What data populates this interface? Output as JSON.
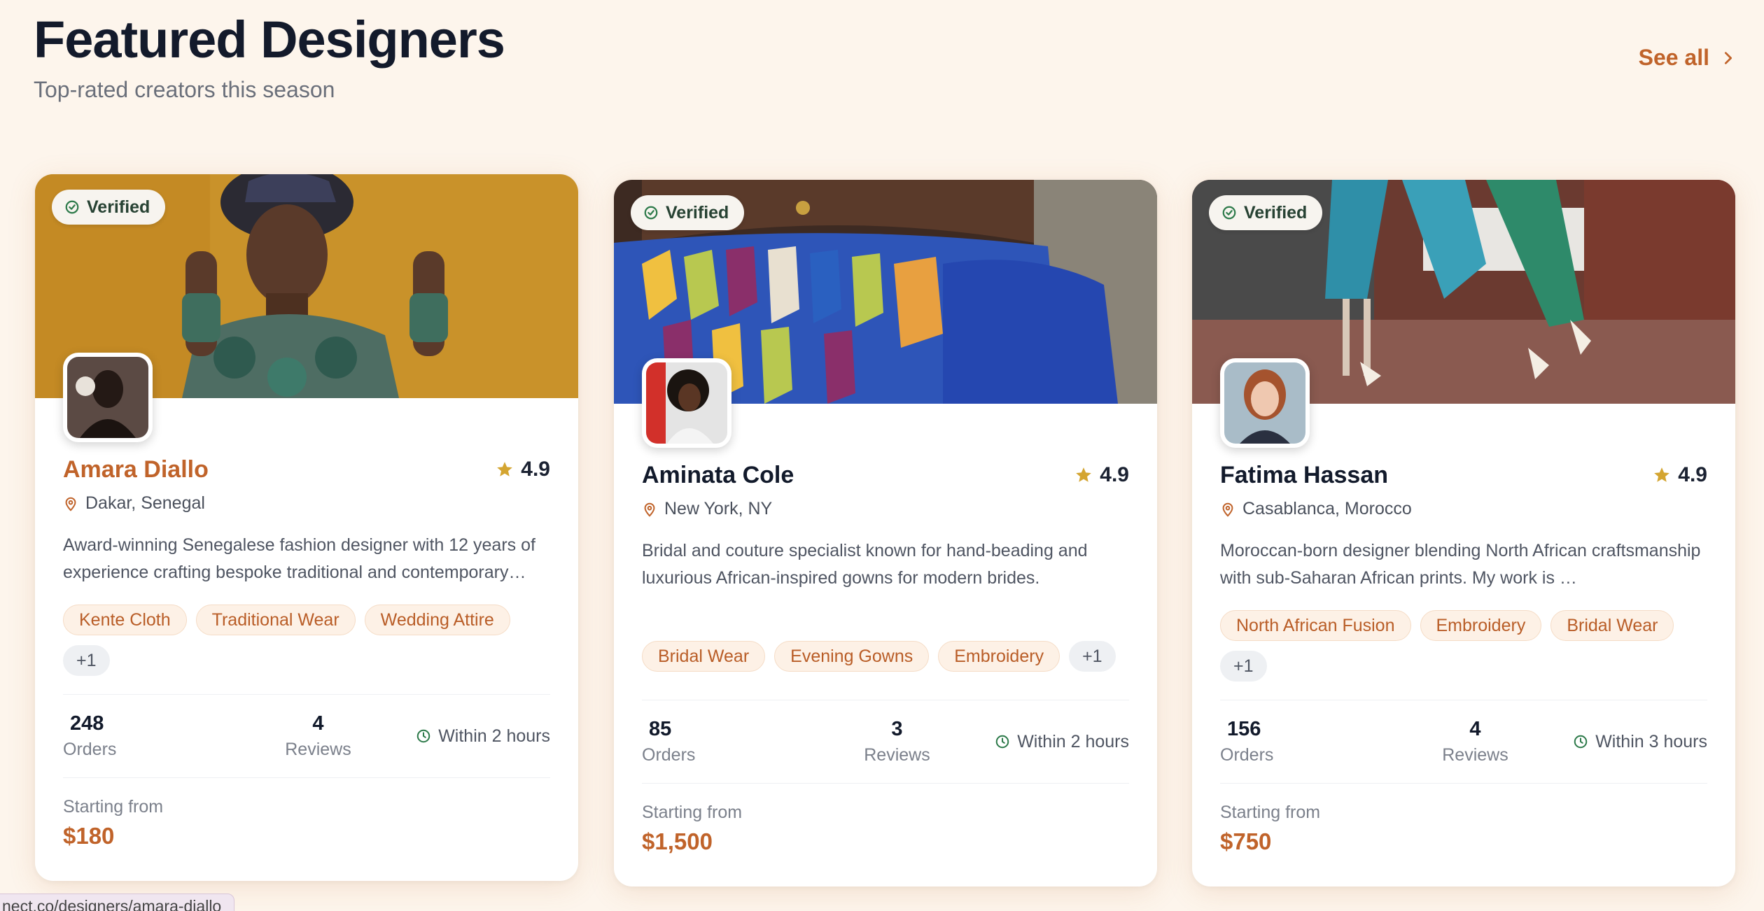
{
  "header": {
    "title": "Featured Designers",
    "subtitle": "Top-rated creators this season",
    "see_all": "See all"
  },
  "colors": {
    "accent": "#c0632a",
    "background": "#fdf5ec",
    "tag_bg": "#fdf1e6",
    "star": "#d4a531"
  },
  "designers": [
    {
      "badge": "Verified",
      "name": "Amara Diallo",
      "rating": "4.9",
      "location": "Dakar, Senegal",
      "bio": "Award-winning Senegalese fashion designer with 12 years of experience crafting bespoke traditional and contemporary…",
      "tags": [
        "Kente Cloth",
        "Traditional Wear",
        "Wedding Attire"
      ],
      "more_tags": "+1",
      "orders": "248",
      "orders_label": "Orders",
      "reviews": "4",
      "reviews_label": "Reviews",
      "response": "Within 2 hours",
      "price_label": "Starting from",
      "price": "$180"
    },
    {
      "badge": "Verified",
      "name": "Aminata Cole",
      "rating": "4.9",
      "location": "New York, NY",
      "bio": "Bridal and couture specialist known for hand-beading and luxurious African-inspired gowns for modern brides.",
      "tags": [
        "Bridal Wear",
        "Evening Gowns",
        "Embroidery"
      ],
      "more_tags": "+1",
      "orders": "85",
      "orders_label": "Orders",
      "reviews": "3",
      "reviews_label": "Reviews",
      "response": "Within 2 hours",
      "price_label": "Starting from",
      "price": "$1,500"
    },
    {
      "badge": "Verified",
      "name": "Fatima Hassan",
      "rating": "4.9",
      "location": "Casablanca, Morocco",
      "bio": "Moroccan-born designer blending North African craftsmanship with sub-Saharan African prints. My work is …",
      "tags": [
        "North African Fusion",
        "Embroidery",
        "Bridal Wear"
      ],
      "more_tags": "+1",
      "orders": "156",
      "orders_label": "Orders",
      "reviews": "4",
      "reviews_label": "Reviews",
      "response": "Within 3 hours",
      "price_label": "Starting from",
      "price": "$750"
    }
  ],
  "status_bar": {
    "url": "nect.co/designers/amara-diallo"
  }
}
